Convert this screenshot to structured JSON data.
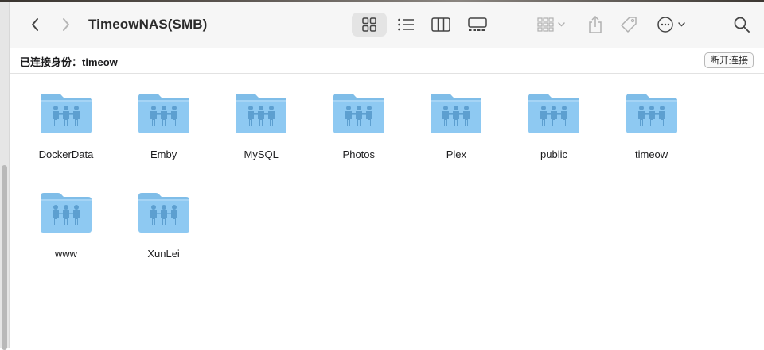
{
  "window": {
    "title": "TimeowNAS(SMB)"
  },
  "connection": {
    "label": "已连接身份：timeow",
    "disconnect_label": "断开连接"
  },
  "toolbar": {
    "icons": [
      "back-icon",
      "forward-icon",
      "icon-view-icon",
      "list-view-icon",
      "column-view-icon",
      "gallery-view-icon",
      "group-icon",
      "share-icon",
      "tag-icon",
      "more-icon",
      "search-icon"
    ],
    "active_view": "icon-view"
  },
  "folders": [
    {
      "name": "DockerData"
    },
    {
      "name": "Emby"
    },
    {
      "name": "MySQL"
    },
    {
      "name": "Photos"
    },
    {
      "name": "Plex"
    },
    {
      "name": "public"
    },
    {
      "name": "timeow"
    },
    {
      "name": "www"
    },
    {
      "name": "XunLei"
    }
  ],
  "colors": {
    "folder_body": "#8ec9f2",
    "folder_tab": "#7fbde8",
    "folder_people": "#5d9fd0",
    "toolbar_bg": "#f6f6f6",
    "active_view_bg": "#e4e4e4"
  }
}
